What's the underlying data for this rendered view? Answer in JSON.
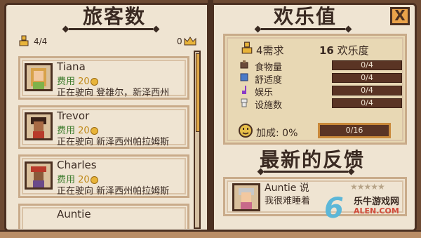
{
  "left_page": {
    "title": "旅客数",
    "capacity_text": "4/4",
    "crown_count": "0",
    "travelers": [
      {
        "name": "Tiana",
        "fee_label": "费用",
        "fee_value": "20",
        "destination": "正在驶向 登雄尔，新泽西州"
      },
      {
        "name": "Trevor",
        "fee_label": "费用",
        "fee_value": "20",
        "destination": "正在驶向 新泽西州帕拉姆斯"
      },
      {
        "name": "Charles",
        "fee_label": "费用",
        "fee_value": "20",
        "destination": "正在驶向 新泽西州帕拉姆斯"
      },
      {
        "name": "Auntie",
        "fee_label": "",
        "fee_value": "",
        "destination": ""
      }
    ]
  },
  "right_page": {
    "title": "欢乐值",
    "close_label": "X",
    "need_text": "4需求",
    "happiness_value": "16",
    "happiness_label": "欢乐度",
    "stats": [
      {
        "label": "食物量",
        "value": "0/4",
        "icon": "food-icon"
      },
      {
        "label": "舒适度",
        "value": "0/4",
        "icon": "comfort-icon"
      },
      {
        "label": "娱乐",
        "value": "0/4",
        "icon": "music-note-icon"
      },
      {
        "label": "设施数",
        "value": "0/4",
        "icon": "toilet-icon"
      }
    ],
    "bonus_label": "加成: 0%",
    "bonus_value": "0/16",
    "feedback_title": "最新的反馈",
    "feedback": {
      "name": "Auntie 说",
      "text": "我很难睡着",
      "stars": "★★★★★"
    }
  },
  "watermark": {
    "logo": "6",
    "site_name": "乐牛游戏网",
    "site_url": "ALEN.COM"
  },
  "colors": {
    "paper": "#efe4d2",
    "ink": "#3a2a22",
    "frame": "#4b3021",
    "bar": "#5a3424",
    "gold": "#e8b43a"
  }
}
